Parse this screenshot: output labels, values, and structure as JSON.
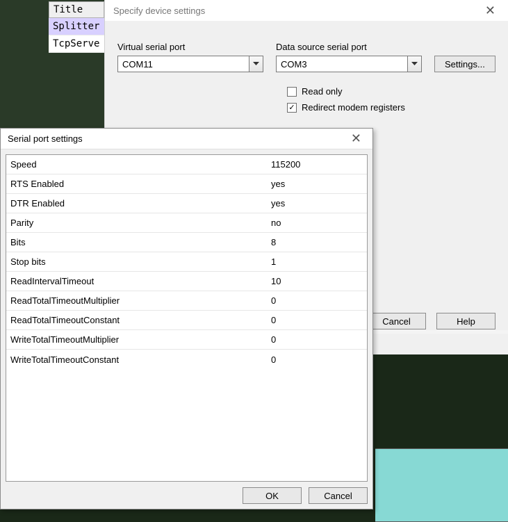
{
  "bgList": {
    "header": "Title",
    "rows": [
      "Splitter",
      "TcpServe"
    ]
  },
  "deviceWin": {
    "title": "Specify device settings",
    "virtualLabel": "Virtual serial port",
    "virtualValue": "COM11",
    "dataSourceLabel": "Data source serial port",
    "dataSourceValue": "COM3",
    "settingsBtn": "Settings...",
    "readOnly": {
      "label": "Read only",
      "checked": false
    },
    "redirect": {
      "label": "Redirect modem registers",
      "checked": true
    },
    "cancelBtn": "Cancel",
    "helpBtn": "Help"
  },
  "serialDlg": {
    "title": "Serial port settings",
    "props": [
      {
        "k": "Speed",
        "v": "115200"
      },
      {
        "k": "RTS Enabled",
        "v": "yes"
      },
      {
        "k": "DTR Enabled",
        "v": "yes"
      },
      {
        "k": "Parity",
        "v": "no"
      },
      {
        "k": "Bits",
        "v": "8"
      },
      {
        "k": "Stop bits",
        "v": "1"
      },
      {
        "k": "ReadIntervalTimeout",
        "v": "10"
      },
      {
        "k": "ReadTotalTimeoutMultiplier",
        "v": "0"
      },
      {
        "k": "ReadTotalTimeoutConstant",
        "v": "0"
      },
      {
        "k": "WriteTotalTimeoutMultiplier",
        "v": "0"
      },
      {
        "k": "WriteTotalTimeoutConstant",
        "v": "0"
      }
    ],
    "okBtn": "OK",
    "cancelBtn": "Cancel"
  }
}
